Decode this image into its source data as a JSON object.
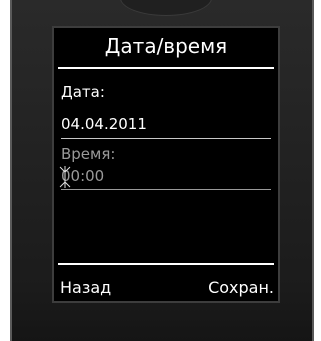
{
  "screen": {
    "title": "Дата/время"
  },
  "fields": {
    "date_label": "Дата:",
    "date_value": "04.04.2011",
    "time_label": "Время:",
    "time_value": "00:00"
  },
  "softkeys": {
    "left": "Назад",
    "right": "Сохран."
  },
  "colors": {
    "screen_bg": "#000000",
    "text_active": "#ffffff",
    "text_inactive": "#9a9a9a",
    "handset_body": "#222222"
  }
}
